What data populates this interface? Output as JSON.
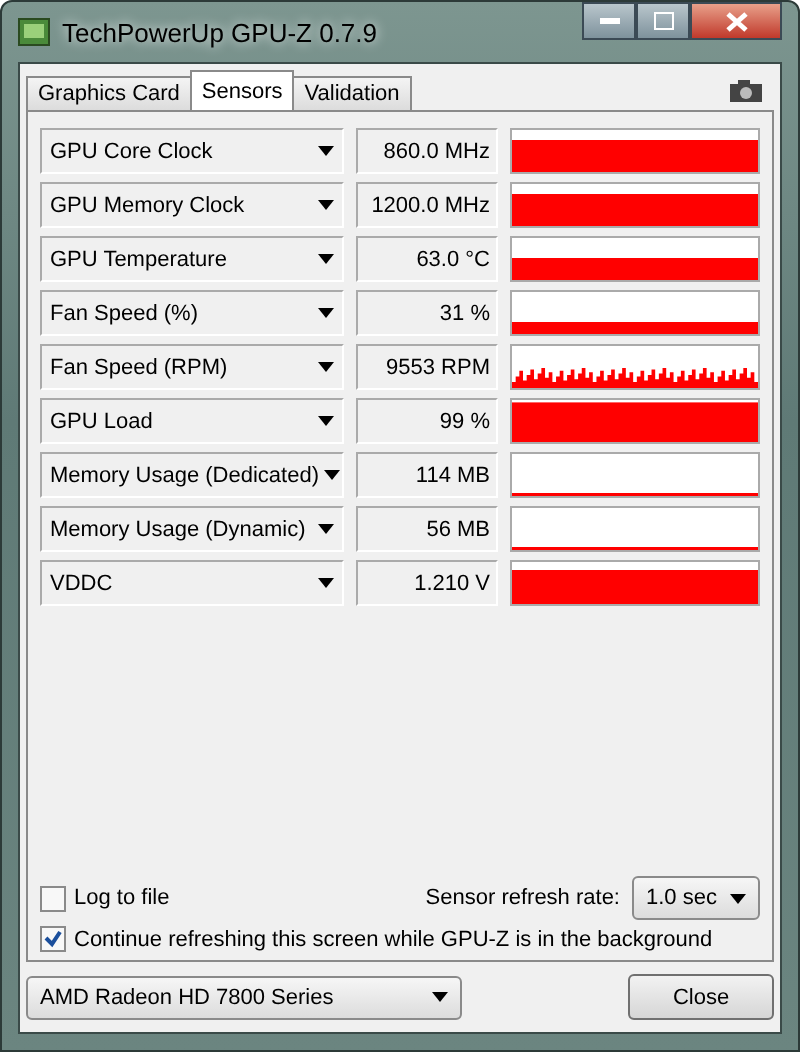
{
  "window": {
    "title": "TechPowerUp GPU-Z 0.7.9"
  },
  "tabs": [
    {
      "label": "Graphics Card",
      "selected": false
    },
    {
      "label": "Sensors",
      "selected": true
    },
    {
      "label": "Validation",
      "selected": false
    }
  ],
  "sensors": [
    {
      "name": "GPU Core Clock",
      "reading": "860.0 MHz",
      "kind": "solid"
    },
    {
      "name": "GPU Memory Clock",
      "reading": "1200.0 MHz",
      "kind": "solid"
    },
    {
      "name": "GPU Temperature",
      "reading": "63.0 °C",
      "kind": "solid"
    },
    {
      "name": "Fan Speed (%)",
      "reading": "31 %",
      "kind": "solid"
    },
    {
      "name": "Fan Speed (RPM)",
      "reading": "9553 RPM",
      "kind": "spiky"
    },
    {
      "name": "GPU Load",
      "reading": "99 %",
      "kind": "solid"
    },
    {
      "name": "Memory Usage (Dedicated)",
      "reading": "114 MB",
      "kind": "solid"
    },
    {
      "name": "Memory Usage (Dynamic)",
      "reading": "56 MB",
      "kind": "solid"
    },
    {
      "name": "VDDC",
      "reading": "1.210 V",
      "kind": "solid"
    }
  ],
  "log_to_file": {
    "label": "Log to file",
    "checked": false
  },
  "refresh_rate": {
    "label": "Sensor refresh rate:",
    "value": "1.0 sec"
  },
  "continue_refreshing": {
    "label": "Continue refreshing this screen while GPU-Z is in the background",
    "checked": true
  },
  "gpu_select": {
    "value": "AMD Radeon HD 7800 Series"
  },
  "buttons": [
    "Close"
  ]
}
